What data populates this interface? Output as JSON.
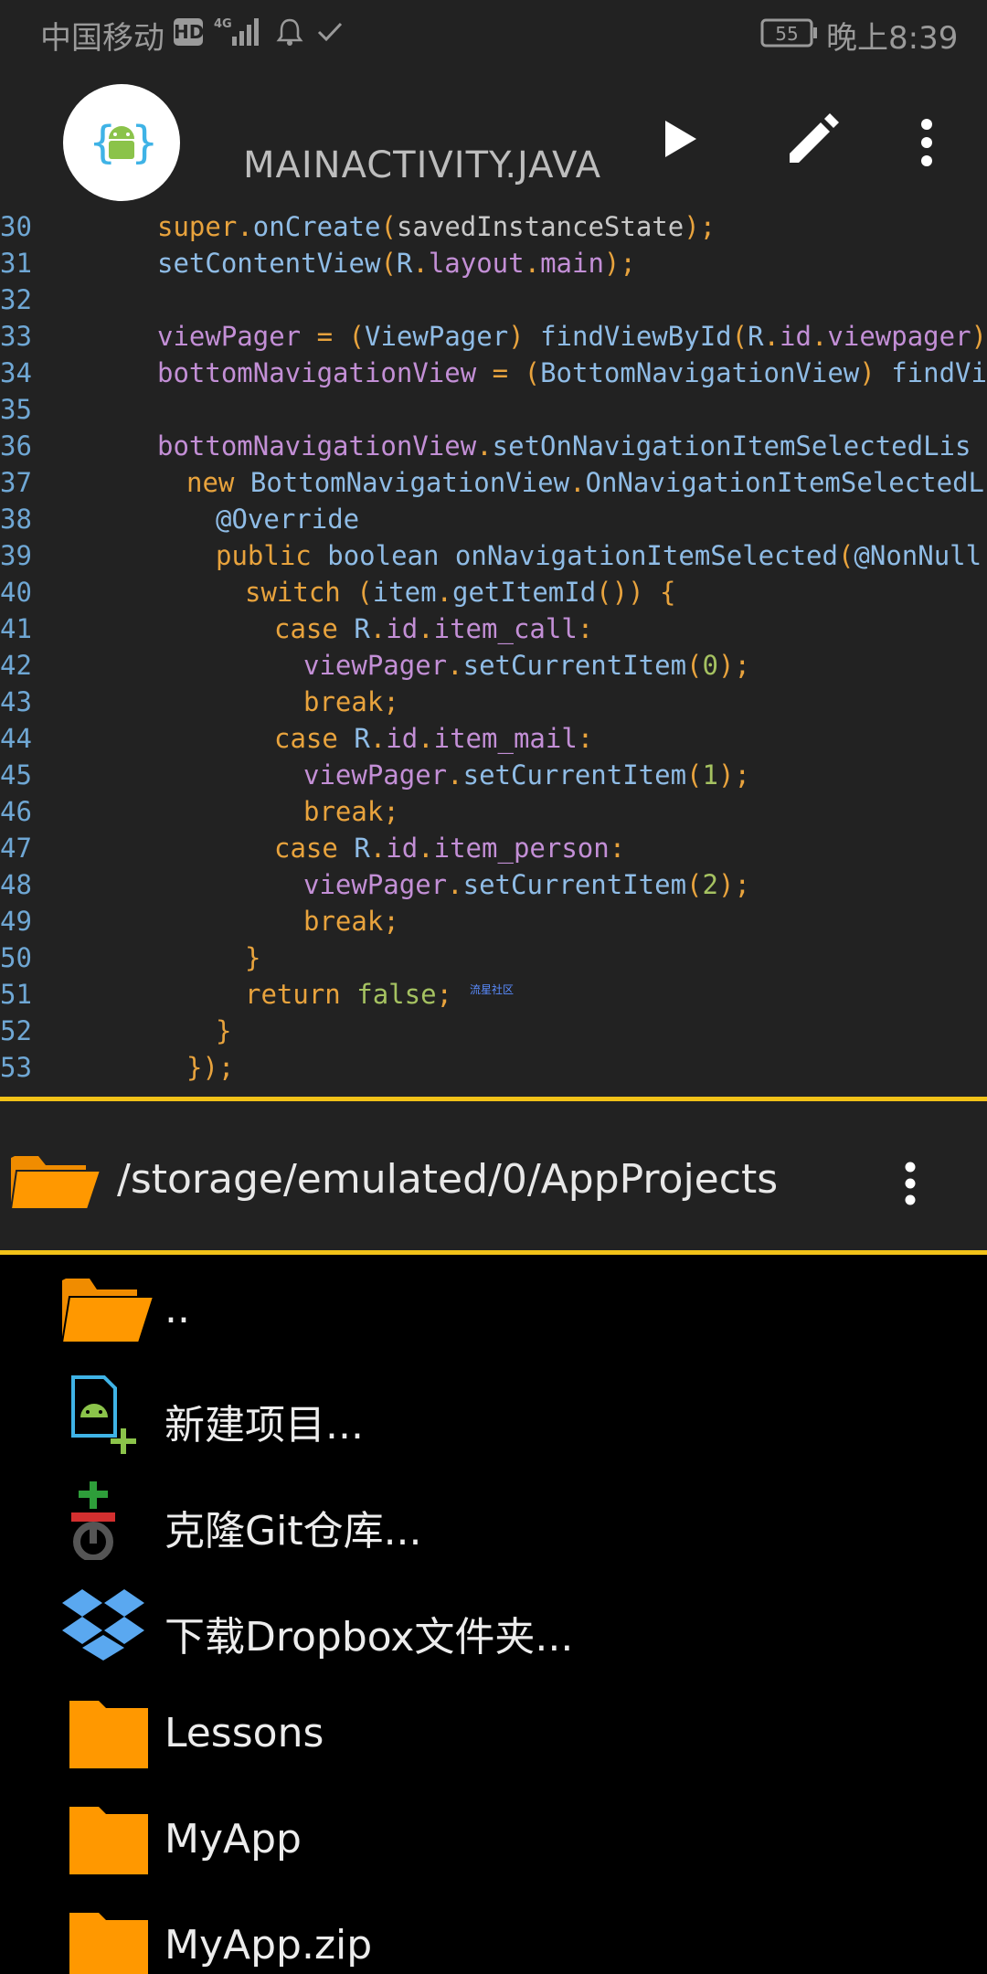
{
  "status_bar": {
    "carrier": "中国移动",
    "hd_badge": "HD",
    "network": "4G",
    "battery": "55",
    "time": "晚上8:39"
  },
  "toolbar": {
    "title": "MAINACTIVITY.JAVA",
    "run_icon": "play-icon",
    "edit_icon": "pencil-icon",
    "more_icon": "more-vert-icon"
  },
  "editor": {
    "lines": [
      {
        "no": "30",
        "indent": 4,
        "tokens": [
          [
            "kw",
            "super"
          ],
          [
            "pun",
            "."
          ],
          [
            "id",
            "onCreate"
          ],
          [
            "pun",
            "("
          ],
          [
            "plain",
            "savedInstanceState"
          ],
          [
            "pun",
            ");"
          ]
        ]
      },
      {
        "no": "31",
        "indent": 4,
        "tokens": [
          [
            "id",
            "setContentView"
          ],
          [
            "pun",
            "("
          ],
          [
            "id",
            "R"
          ],
          [
            "pun",
            "."
          ],
          [
            "fld",
            "layout"
          ],
          [
            "pun",
            "."
          ],
          [
            "fld",
            "main"
          ],
          [
            "pun",
            ");"
          ]
        ]
      },
      {
        "no": "32",
        "indent": 0,
        "tokens": []
      },
      {
        "no": "33",
        "indent": 4,
        "tokens": [
          [
            "fld",
            "viewPager"
          ],
          [
            "plain",
            " "
          ],
          [
            "pun",
            "="
          ],
          [
            "plain",
            " "
          ],
          [
            "pun",
            "("
          ],
          [
            "id",
            "ViewPager"
          ],
          [
            "pun",
            ")"
          ],
          [
            "plain",
            " "
          ],
          [
            "id",
            "findViewById"
          ],
          [
            "pun",
            "("
          ],
          [
            "id",
            "R"
          ],
          [
            "pun",
            "."
          ],
          [
            "fld",
            "id"
          ],
          [
            "pun",
            "."
          ],
          [
            "fld",
            "viewpager"
          ],
          [
            "pun",
            ");"
          ]
        ]
      },
      {
        "no": "34",
        "indent": 4,
        "tokens": [
          [
            "fld",
            "bottomNavigationView"
          ],
          [
            "plain",
            " "
          ],
          [
            "pun",
            "="
          ],
          [
            "plain",
            " "
          ],
          [
            "pun",
            "("
          ],
          [
            "id",
            "BottomNavigationView"
          ],
          [
            "pun",
            ")"
          ],
          [
            "plain",
            " "
          ],
          [
            "id",
            "findVie"
          ]
        ]
      },
      {
        "no": "35",
        "indent": 0,
        "tokens": []
      },
      {
        "no": "36",
        "indent": 4,
        "tokens": [
          [
            "fld",
            "bottomNavigationView"
          ],
          [
            "pun",
            "."
          ],
          [
            "id",
            "setOnNavigationItemSelectedLis"
          ]
        ]
      },
      {
        "no": "37",
        "indent": 5,
        "tokens": [
          [
            "kw",
            "new"
          ],
          [
            "plain",
            " "
          ],
          [
            "id",
            "BottomNavigationView"
          ],
          [
            "pun",
            "."
          ],
          [
            "id",
            "OnNavigationItemSelectedL"
          ]
        ]
      },
      {
        "no": "38",
        "indent": 6,
        "tokens": [
          [
            "ann",
            "@Override"
          ]
        ]
      },
      {
        "no": "39",
        "indent": 6,
        "tokens": [
          [
            "kw",
            "public"
          ],
          [
            "plain",
            " "
          ],
          [
            "id",
            "boolean"
          ],
          [
            "plain",
            " "
          ],
          [
            "id",
            "onNavigationItemSelected"
          ],
          [
            "pun",
            "("
          ],
          [
            "ann",
            "@NonNull"
          ]
        ]
      },
      {
        "no": "40",
        "indent": 7,
        "tokens": [
          [
            "kw",
            "switch"
          ],
          [
            "plain",
            " "
          ],
          [
            "pun",
            "("
          ],
          [
            "id",
            "item"
          ],
          [
            "pun",
            "."
          ],
          [
            "id",
            "getItemId"
          ],
          [
            "pun",
            "())"
          ],
          [
            "plain",
            " "
          ],
          [
            "pun",
            "{"
          ]
        ]
      },
      {
        "no": "41",
        "indent": 8,
        "tokens": [
          [
            "kw",
            "case"
          ],
          [
            "plain",
            " "
          ],
          [
            "id",
            "R"
          ],
          [
            "pun",
            "."
          ],
          [
            "fld",
            "id"
          ],
          [
            "pun",
            "."
          ],
          [
            "fld",
            "item_call"
          ],
          [
            "pun",
            ":"
          ]
        ]
      },
      {
        "no": "42",
        "indent": 9,
        "tokens": [
          [
            "fld",
            "viewPager"
          ],
          [
            "pun",
            "."
          ],
          [
            "id",
            "setCurrentItem"
          ],
          [
            "pun",
            "("
          ],
          [
            "num",
            "0"
          ],
          [
            "pun",
            ");"
          ]
        ]
      },
      {
        "no": "43",
        "indent": 9,
        "tokens": [
          [
            "kw",
            "break"
          ],
          [
            "pun",
            ";"
          ]
        ]
      },
      {
        "no": "44",
        "indent": 8,
        "tokens": [
          [
            "kw",
            "case"
          ],
          [
            "plain",
            " "
          ],
          [
            "id",
            "R"
          ],
          [
            "pun",
            "."
          ],
          [
            "fld",
            "id"
          ],
          [
            "pun",
            "."
          ],
          [
            "fld",
            "item_mail"
          ],
          [
            "pun",
            ":"
          ]
        ]
      },
      {
        "no": "45",
        "indent": 9,
        "tokens": [
          [
            "fld",
            "viewPager"
          ],
          [
            "pun",
            "."
          ],
          [
            "id",
            "setCurrentItem"
          ],
          [
            "pun",
            "("
          ],
          [
            "num",
            "1"
          ],
          [
            "pun",
            ");"
          ]
        ]
      },
      {
        "no": "46",
        "indent": 9,
        "tokens": [
          [
            "kw",
            "break"
          ],
          [
            "pun",
            ";"
          ]
        ]
      },
      {
        "no": "47",
        "indent": 8,
        "tokens": [
          [
            "kw",
            "case"
          ],
          [
            "plain",
            " "
          ],
          [
            "id",
            "R"
          ],
          [
            "pun",
            "."
          ],
          [
            "fld",
            "id"
          ],
          [
            "pun",
            "."
          ],
          [
            "fld",
            "item_person"
          ],
          [
            "pun",
            ":"
          ]
        ]
      },
      {
        "no": "48",
        "indent": 9,
        "tokens": [
          [
            "fld",
            "viewPager"
          ],
          [
            "pun",
            "."
          ],
          [
            "id",
            "setCurrentItem"
          ],
          [
            "pun",
            "("
          ],
          [
            "num",
            "2"
          ],
          [
            "pun",
            ");"
          ]
        ]
      },
      {
        "no": "49",
        "indent": 9,
        "tokens": [
          [
            "kw",
            "break"
          ],
          [
            "pun",
            ";"
          ]
        ]
      },
      {
        "no": "50",
        "indent": 7,
        "tokens": [
          [
            "pun",
            "}"
          ]
        ]
      },
      {
        "no": "51",
        "indent": 7,
        "tokens": [
          [
            "kw",
            "return"
          ],
          [
            "plain",
            " "
          ],
          [
            "lit",
            "false"
          ],
          [
            "pun",
            ";"
          ]
        ]
      },
      {
        "no": "52",
        "indent": 6,
        "tokens": [
          [
            "pun",
            "}"
          ]
        ]
      },
      {
        "no": "53",
        "indent": 5,
        "tokens": [
          [
            "pun",
            "});"
          ]
        ]
      }
    ],
    "watermark": "流星社区"
  },
  "path_bar": {
    "path": "/storage/emulated/0/AppProjects",
    "folder_icon": "folder-open-icon",
    "more_icon": "more-vert-icon"
  },
  "files": [
    {
      "label": "..",
      "icon": "folder-open-icon",
      "name": "file-item-parent"
    },
    {
      "label": "新建项目...",
      "icon": "new-android-project-icon",
      "name": "file-item-new-project"
    },
    {
      "label": "克隆Git仓库...",
      "icon": "git-clone-icon",
      "name": "file-item-clone-git"
    },
    {
      "label": "下载Dropbox文件夹...",
      "icon": "dropbox-icon",
      "name": "file-item-dropbox"
    },
    {
      "label": "Lessons",
      "icon": "folder-icon",
      "name": "file-item-lessons"
    },
    {
      "label": "MyApp",
      "icon": "folder-icon",
      "name": "file-item-myapp"
    },
    {
      "label": "MyApp.zip",
      "icon": "folder-icon",
      "name": "file-item-myapp-zip"
    }
  ],
  "colors": {
    "accent_yellow": "#f2c218",
    "folder_orange": "#ff9800",
    "toolbar_bg": "#222222",
    "list_bg": "#000000"
  }
}
